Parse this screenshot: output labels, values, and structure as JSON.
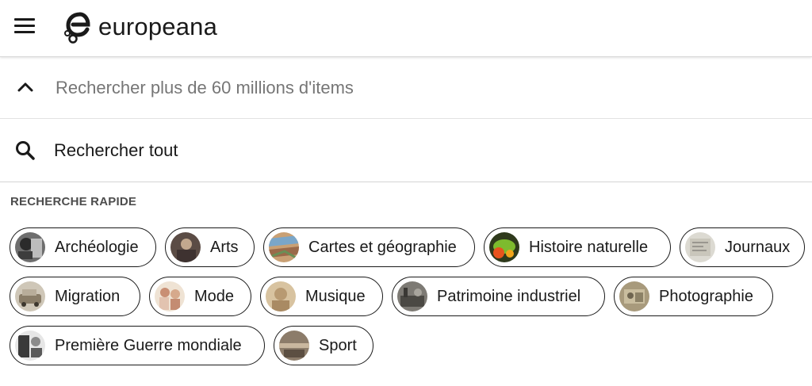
{
  "header": {
    "brand": "europeana",
    "menu_icon": "hamburger-menu-icon",
    "logo_icon": "europeana-logo-icon"
  },
  "search": {
    "collapse_icon": "chevron-up-icon",
    "placeholder": "Rechercher plus de 60 millions d'items"
  },
  "suggestion": {
    "icon": "search-icon",
    "label": "Rechercher tout"
  },
  "quick_search": {
    "title": "RECHERCHE RAPIDE",
    "items": [
      {
        "label": "Archéologie"
      },
      {
        "label": "Arts"
      },
      {
        "label": "Cartes et géographie"
      },
      {
        "label": "Histoire naturelle"
      },
      {
        "label": "Journaux"
      },
      {
        "label": "Migration"
      },
      {
        "label": "Mode"
      },
      {
        "label": "Musique"
      },
      {
        "label": "Patrimoine industriel"
      },
      {
        "label": "Photographie"
      },
      {
        "label": "Première Guerre mondiale"
      },
      {
        "label": "Sport"
      }
    ]
  },
  "colors": {
    "text": "#1a1a1a",
    "muted": "#767676",
    "border": "#1a1a1a"
  }
}
